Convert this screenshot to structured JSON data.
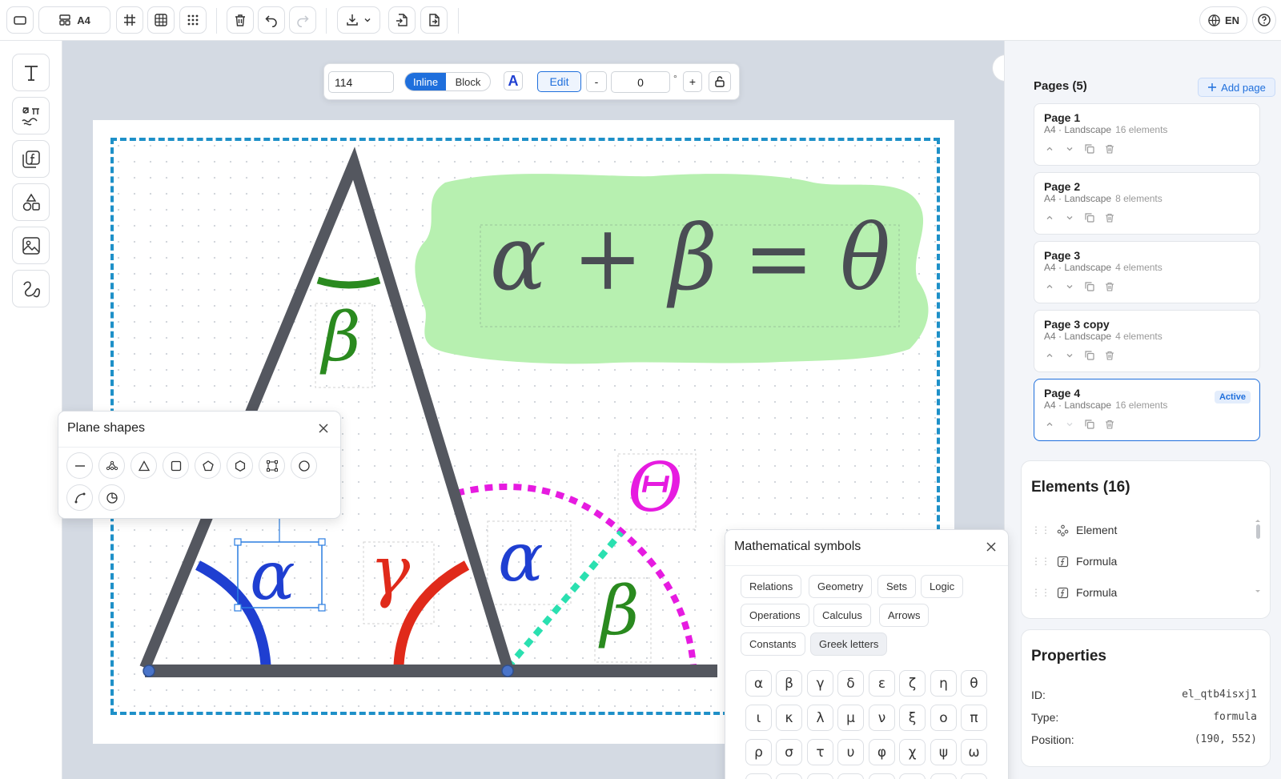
{
  "toolbar": {
    "page_size": "A4",
    "language": "EN"
  },
  "formula_toolbar": {
    "size_value": "114",
    "inline_label": "Inline",
    "block_label": "Block",
    "color_label": "A",
    "edit_label": "Edit",
    "minus_label": "-",
    "rotation_value": "0",
    "degree_symbol": "°",
    "plus_label": "+"
  },
  "canvas": {
    "main_formula": "α + β = θ",
    "labels": {
      "beta_top": "β",
      "alpha_selected": "α",
      "gamma": "γ",
      "alpha_right": "α",
      "theta": "Θ",
      "beta_right": "β"
    },
    "colors": {
      "triangle": "#54575f",
      "green": "#2a8a1f",
      "blue": "#1f3fd1",
      "red": "#e02a1a",
      "magenta": "#e61be0",
      "teal": "#2ae0b0",
      "highlight": "#b7f0b0",
      "frame": "#1e90c8"
    }
  },
  "plane_shapes": {
    "title": "Plane shapes",
    "shapes": [
      "line-icon",
      "polyline-icon",
      "triangle-icon",
      "square-icon",
      "pentagon-icon",
      "hexagon-icon",
      "rectangle-icon",
      "circle-icon",
      "arc-icon",
      "sector-icon"
    ]
  },
  "math_symbols": {
    "title": "Mathematical symbols",
    "categories": [
      "Relations",
      "Geometry",
      "Sets",
      "Logic",
      "Operations",
      "Calculus",
      "Arrows",
      "Constants",
      "Greek letters"
    ],
    "selected_category": "Greek letters",
    "symbols": [
      "α",
      "β",
      "γ",
      "δ",
      "ε",
      "ζ",
      "η",
      "θ",
      "ι",
      "κ",
      "λ",
      "μ",
      "ν",
      "ξ",
      "ο",
      "π",
      "ρ",
      "σ",
      "τ",
      "υ",
      "φ",
      "χ",
      "ψ",
      "ω"
    ]
  },
  "sidebar": {
    "pages_title": "Pages (5)",
    "add_page_label": "Add page",
    "pages": [
      {
        "name": "Page 1",
        "meta": "A4 · Landscape",
        "count": "16 elements",
        "active": false
      },
      {
        "name": "Page 2",
        "meta": "A4 · Landscape",
        "count": "8 elements",
        "active": false
      },
      {
        "name": "Page 3",
        "meta": "A4 · Landscape",
        "count": "4 elements",
        "active": false
      },
      {
        "name": "Page 3 copy",
        "meta": "A4 · Landscape",
        "count": "4 elements",
        "active": false
      },
      {
        "name": "Page 4",
        "meta": "A4 · Landscape",
        "count": "16 elements",
        "active": true
      }
    ],
    "active_badge": "Active",
    "elements_title": "Elements (16)",
    "elements": [
      {
        "label": "Element",
        "icon": "shape-element-icon"
      },
      {
        "label": "Formula",
        "icon": "formula-icon"
      },
      {
        "label": "Formula",
        "icon": "formula-icon"
      }
    ],
    "properties_title": "Properties",
    "properties": [
      {
        "key": "ID:",
        "value": "el_qtb4isxj1"
      },
      {
        "key": "Type:",
        "value": "formula"
      },
      {
        "key": "Position:",
        "value": "(190, 552)"
      }
    ]
  }
}
